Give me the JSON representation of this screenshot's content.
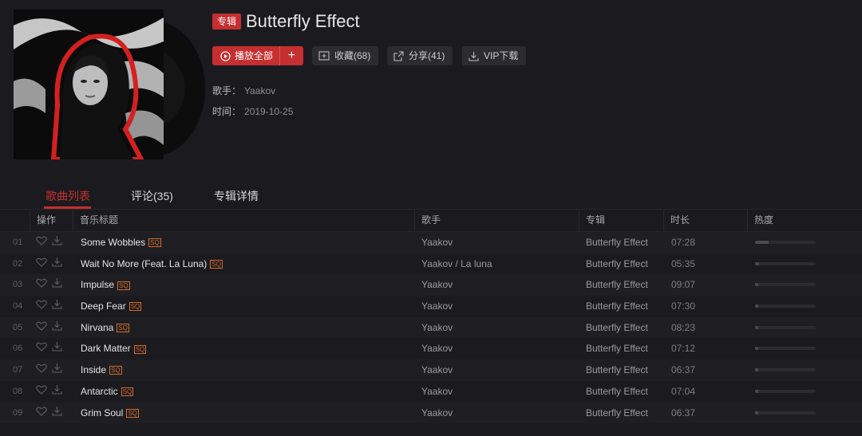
{
  "album": {
    "tag": "专辑",
    "title": "Butterfly Effect",
    "artist_label": "歌手：",
    "artist": "Yaakov",
    "date_label": "时间：",
    "date": "2019-10-25"
  },
  "actions": {
    "play_all": "播放全部",
    "add": "+",
    "favorite": "收藏(68)",
    "share": "分享(41)",
    "vip_download": "VIP下载"
  },
  "tabs": [
    {
      "label": "歌曲列表",
      "active": true
    },
    {
      "label": "评论(35)",
      "active": false
    },
    {
      "label": "专辑详情",
      "active": false
    }
  ],
  "columns": [
    "操作",
    "音乐标题",
    "歌手",
    "专辑",
    "时长",
    "热度"
  ],
  "quality_badge": "SQ",
  "tracks": [
    {
      "num": "01",
      "title": "Some Wobbles",
      "artist": "Yaakov",
      "album": "Butterfly Effect",
      "duration": "07:28",
      "heat": 0.22
    },
    {
      "num": "02",
      "title": "Wait No More (Feat. La Luna)",
      "artist": "Yaakov / La luna",
      "album": "Butterfly Effect",
      "duration": "05:35",
      "heat": 0.06
    },
    {
      "num": "03",
      "title": "Impulse",
      "artist": "Yaakov",
      "album": "Butterfly Effect",
      "duration": "09:07",
      "heat": 0.05
    },
    {
      "num": "04",
      "title": "Deep Fear",
      "artist": "Yaakov",
      "album": "Butterfly Effect",
      "duration": "07:30",
      "heat": 0.05
    },
    {
      "num": "05",
      "title": "Nirvana",
      "artist": "Yaakov",
      "album": "Butterfly Effect",
      "duration": "08:23",
      "heat": 0.05
    },
    {
      "num": "06",
      "title": "Dark Matter",
      "artist": "Yaakov",
      "album": "Butterfly Effect",
      "duration": "07:12",
      "heat": 0.05
    },
    {
      "num": "07",
      "title": "Inside",
      "artist": "Yaakov",
      "album": "Butterfly Effect",
      "duration": "06:37",
      "heat": 0.05
    },
    {
      "num": "08",
      "title": "Antarctic",
      "artist": "Yaakov",
      "album": "Butterfly Effect",
      "duration": "07:04",
      "heat": 0.05
    },
    {
      "num": "09",
      "title": "Grim Soul",
      "artist": "Yaakov",
      "album": "Butterfly Effect",
      "duration": "06:37",
      "heat": 0.05
    }
  ],
  "icons": {
    "play": "play-circle-icon",
    "favorite": "folder-plus-icon",
    "share": "share-icon",
    "download": "download-icon",
    "like": "heart-icon"
  },
  "colors": {
    "accent": "#c62f2f",
    "background": "#1b1b1f",
    "quality_badge": "#d36a2a"
  }
}
